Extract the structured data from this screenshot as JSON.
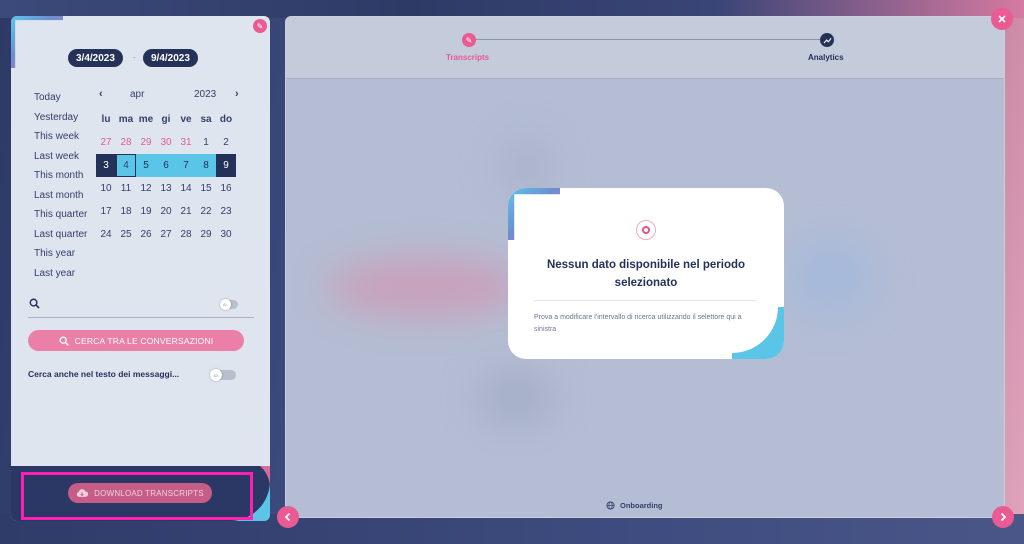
{
  "date_range": {
    "start": "3/4/2023",
    "separator": "-",
    "end": "9/4/2023"
  },
  "quick_ranges": [
    "Today",
    "Yesterday",
    "This week",
    "Last week",
    "This month",
    "Last month",
    "This quarter",
    "Last quarter",
    "This year",
    "Last year"
  ],
  "calendar": {
    "prev": "‹",
    "next": "›",
    "month": "apr",
    "year": "2023",
    "weekdays": [
      "lu",
      "ma",
      "me",
      "gi",
      "ve",
      "sa",
      "do"
    ],
    "rows": [
      [
        "27",
        "28",
        "29",
        "30",
        "31",
        "1",
        "2"
      ],
      [
        "3",
        "4",
        "5",
        "6",
        "7",
        "8",
        "9"
      ],
      [
        "10",
        "11",
        "12",
        "13",
        "14",
        "15",
        "16"
      ],
      [
        "17",
        "18",
        "19",
        "20",
        "21",
        "22",
        "23"
      ],
      [
        "24",
        "25",
        "26",
        "27",
        "28",
        "29",
        "30"
      ]
    ]
  },
  "search": {
    "toggle_label": "A/-"
  },
  "cerca_button": "CERCA TRA LE CONVERSAZIONI",
  "search_messages": {
    "label": "Cerca anche nel testo dei messaggi...",
    "toggle_label": "SX"
  },
  "download_button": "DOWNLOAD TRANSCRIPTS",
  "steps": [
    {
      "label": "Transcripts",
      "icon": "pencil-icon",
      "color": "#ea5a93"
    },
    {
      "label": "Analytics",
      "icon": "chart-icon",
      "color": "#24325a"
    }
  ],
  "empty_state": {
    "title": "Nessun dato disponibile nel periodo selezionato",
    "text": "Prova a modificare l'intervallo di ricerca utilizzando il selettore qui a sinistra"
  },
  "footer": {
    "onboarding": "Onboarding"
  },
  "colors": {
    "accent": "#ea5a93",
    "navy": "#24325a",
    "cyan": "#5bc5e8"
  }
}
